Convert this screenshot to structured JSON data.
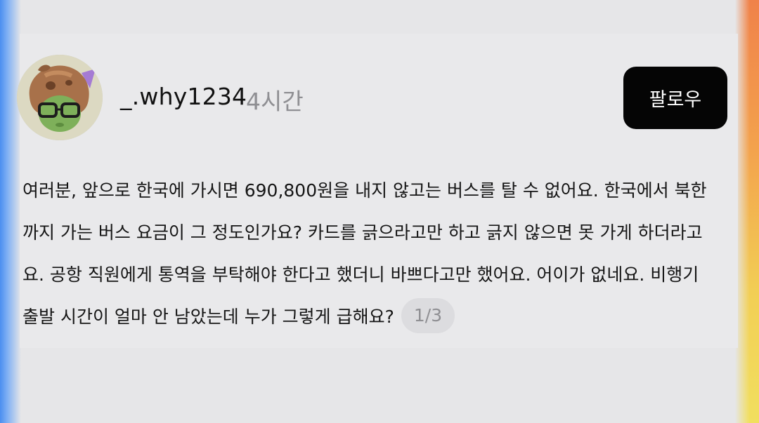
{
  "post": {
    "username": "_.why1234",
    "time": "4시간",
    "follow_label": "팔로우",
    "text": "여러분, 앞으로 한국에 가시면 690,800원을 내지 않고는 버스를 탈 수 없어요. 한국에서 북한까지 가는 버스 요금이 그 정도인가요? 카드를 긁으라고만 하고 긁지 않으면 못 가게 하더라고요. 공항 직원에게 통역을 부탁해야 한다고 했더니 바쁘다고만 했어요. 어이가 없네요. 비행기 출발 시간이 얼마 안 남았는데 누가 그렇게 급해요?",
    "page_indicator": "1/3"
  },
  "avatar": {
    "icon": "horse-hood-avatar-icon"
  },
  "colors": {
    "background": "#e6e6e8",
    "follow_button": "#050505",
    "meta_text": "#8f8f93",
    "edge_left": "#4b8ef0",
    "edge_right_top": "#f0824a",
    "edge_right_bottom": "#f1df5f"
  }
}
